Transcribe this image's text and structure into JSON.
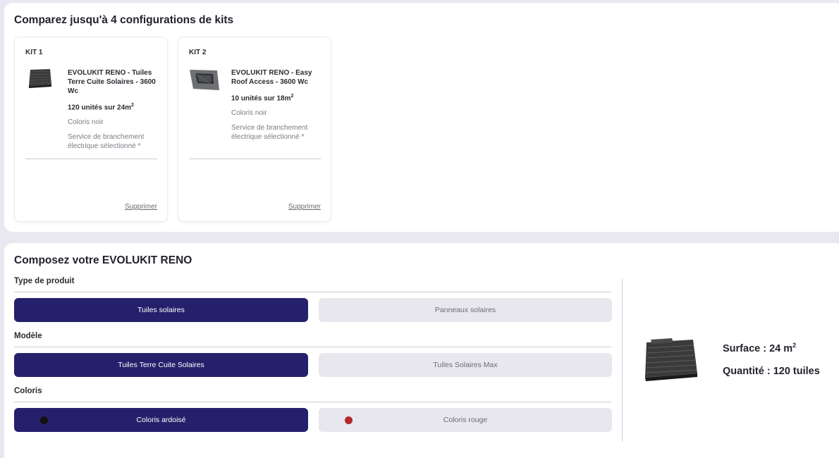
{
  "compare": {
    "title": "Comparez jusqu'à 4 configurations de kits",
    "kits": [
      {
        "label": "KIT 1",
        "name": "EVOLUKIT RENO - Tuiles Terre Cuite Solaires - 3600 Wc",
        "units": "120 unités sur 24m",
        "units_sup": "2",
        "color": "Coloris noir",
        "service": "Service de branchement électrique sélectionné *",
        "delete_label": "Supprimer",
        "icon": "solar-tile-icon"
      },
      {
        "label": "KIT 2",
        "name": "EVOLUKIT RENO - Easy Roof Access - 3600 Wc",
        "units": "10 unités sur 18m",
        "units_sup": "2",
        "color": "Coloris noir",
        "service": "Service de branchement électrique sélectionné *",
        "delete_label": "Supprimer",
        "icon": "roof-access-icon"
      }
    ]
  },
  "compose": {
    "title": "Composez votre EVOLUKIT RENO",
    "groups": {
      "type": {
        "label": "Type de produit",
        "options": [
          "Tuiles solaires",
          "Panneaux solaires"
        ],
        "selected": 0
      },
      "model": {
        "label": "Modèle",
        "options": [
          "Tuiles Terre Cuite Solaires",
          "Tuiles Solaires Max"
        ],
        "selected": 0
      },
      "color": {
        "label": "Coloris",
        "options": [
          "Coloris ardoisé",
          "Coloris rouge"
        ],
        "selected": 0,
        "swatches": [
          "#111111",
          "#b3262b"
        ]
      }
    },
    "summary": {
      "surface": "Surface : 24 m",
      "surface_sup": "2",
      "quantity": "Quantité : 120 tuiles",
      "icon": "solar-tile-icon"
    }
  },
  "colors": {
    "accent": "#25206b",
    "inactive_bg": "#e8e7ee",
    "page_bg": "#e9e8f1"
  }
}
